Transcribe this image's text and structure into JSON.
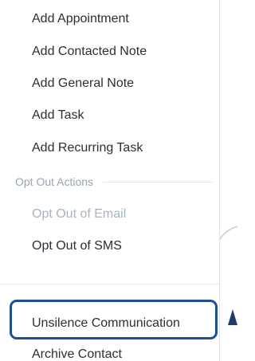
{
  "menu": {
    "items": [
      {
        "label": "Add Appointment"
      },
      {
        "label": "Add Contacted Note"
      },
      {
        "label": "Add General Note"
      },
      {
        "label": "Add Task"
      },
      {
        "label": "Add Recurring Task"
      }
    ],
    "opt_out_section": {
      "header": "Opt Out Actions",
      "items": [
        {
          "label": "Opt Out of Email",
          "disabled": true
        },
        {
          "label": "Opt Out of SMS",
          "disabled": false
        }
      ]
    },
    "communication_items": [
      {
        "label": "Unsilence Communication",
        "highlighted": true
      },
      {
        "label": "Archive Contact"
      }
    ]
  },
  "colors": {
    "text": "#2b2f36",
    "muted": "#9aa4b3",
    "disabled": "#a9b3c2",
    "highlight_border": "#1c4f93"
  }
}
